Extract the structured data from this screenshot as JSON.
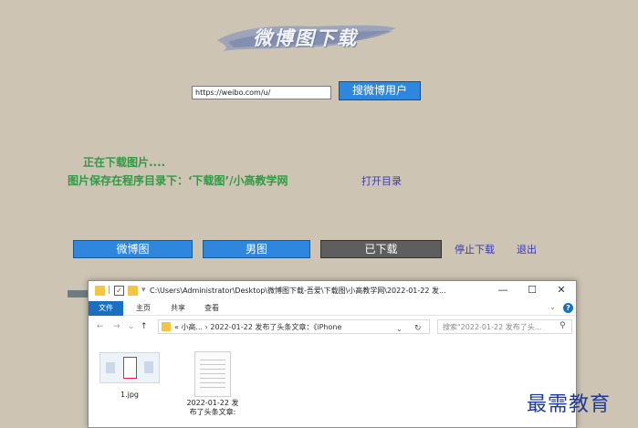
{
  "app": {
    "title": "微博图下载"
  },
  "search": {
    "url_value": "https://weibo.com/u/",
    "button_label": "搜微博用户"
  },
  "status": {
    "line1": "正在下载图片....",
    "line2": "图片保存在程序目录下：‘下载图’/小高教学网",
    "open_dir_label": "打开目录"
  },
  "tabs": [
    {
      "label": "微博图"
    },
    {
      "label": "男图"
    },
    {
      "label": "已下载"
    }
  ],
  "actions": {
    "stop_label": "停止下载",
    "exit_label": "退出"
  },
  "explorer": {
    "title_path": "C:\\Users\\Administrator\\Desktop\\微博图下载-吾爱\\下载图\\小高教学网\\2022-01-22 发...",
    "window_controls": {
      "minimize": "—",
      "maximize": "☐",
      "close": "✕"
    },
    "ribbon": {
      "file": "文件",
      "home": "主页",
      "share": "共享",
      "view": "查看"
    },
    "address_text": "« 小高... › 2022-01-22 发布了头条文章：《iPhone",
    "search_placeholder": "搜索\"2022-01-22 发布了头...",
    "files": [
      {
        "name": "1.jpg"
      },
      {
        "name_line1": "2022-01-22 发",
        "name_line2": "布了头条文章:"
      }
    ]
  },
  "watermark": "最需教育",
  "colors": {
    "background": "#cdc4b3",
    "accent_blue": "#2f86dd",
    "status_green": "#2f9a43",
    "link_purple": "#3a3aa8",
    "downloaded_tab": "#5e5e5e"
  }
}
